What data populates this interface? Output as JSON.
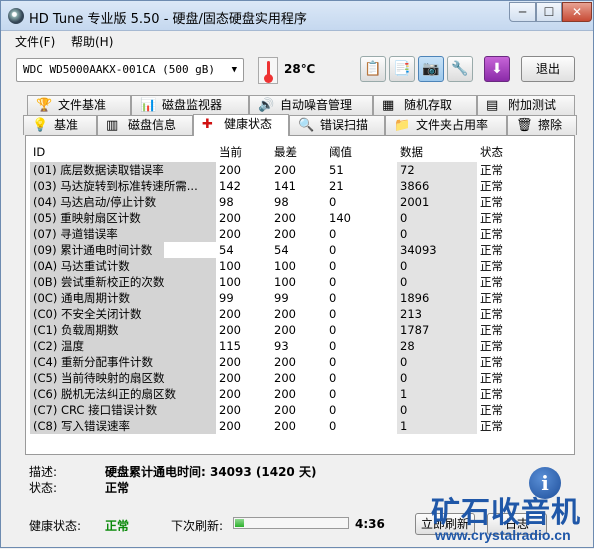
{
  "window": {
    "title": "HD Tune 专业版 5.50 - 硬盘/固态硬盘实用程序",
    "min_icon": "minimize-icon",
    "max_icon": "maximize-icon",
    "close_icon": "close-icon",
    "min_glyph": "─",
    "max_glyph": "☐",
    "close_glyph": "✕"
  },
  "menu": {
    "file": "文件(F)",
    "help": "帮助(H)"
  },
  "toolbar": {
    "drive": "WDC WD5000AAKX-001CA (500 gB)",
    "drive_arrow": "▼",
    "temperature": "28℃",
    "exit": "退出",
    "buttons": [
      {
        "icon": "copy-text-icon",
        "glyph": "📋"
      },
      {
        "icon": "copy-info-icon",
        "glyph": "📑"
      },
      {
        "icon": "screenshot-camera-icon",
        "glyph": "📷"
      },
      {
        "icon": "options-wrench-icon",
        "glyph": "🔧"
      },
      {
        "icon": "save-download-icon",
        "glyph": "⬇"
      }
    ]
  },
  "tabs": {
    "top": [
      {
        "label": "文件基准",
        "icon": "file-benchmark-icon",
        "glyph": "🏆"
      },
      {
        "label": "磁盘监视器",
        "icon": "disk-monitor-icon",
        "glyph": "📊"
      },
      {
        "label": "自动噪音管理",
        "icon": "aam-speaker-icon",
        "glyph": "🔊"
      },
      {
        "label": "随机存取",
        "icon": "random-access-icon",
        "glyph": "▦"
      },
      {
        "label": "附加测试",
        "icon": "extra-tests-icon",
        "glyph": "▤"
      }
    ],
    "bottom": [
      {
        "label": "基准",
        "icon": "benchmark-icon",
        "glyph": "💡"
      },
      {
        "label": "磁盘信息",
        "icon": "disk-info-icon",
        "glyph": "▥"
      },
      {
        "label": "健康状态",
        "icon": "health-cross-icon",
        "glyph": "✚"
      },
      {
        "label": "错误扫描",
        "icon": "error-scan-icon",
        "glyph": "🔍"
      },
      {
        "label": "文件夹占用率",
        "icon": "folder-usage-icon",
        "glyph": "📁"
      },
      {
        "label": "擦除",
        "icon": "erase-trash-icon",
        "glyph": "🗑"
      }
    ]
  },
  "smart": {
    "headers": {
      "id": "ID",
      "current": "当前",
      "worst": "最差",
      "threshold": "阈值",
      "data": "数据",
      "status": "状态"
    },
    "rows": [
      {
        "id": "(01) 底层数据读取错误率",
        "current": "200",
        "worst": "200",
        "threshold": "51",
        "data": "72",
        "status": "正常"
      },
      {
        "id": "(03) 马达旋转到标准转速所需...",
        "current": "142",
        "worst": "141",
        "threshold": "21",
        "data": "3866",
        "status": "正常"
      },
      {
        "id": "(04) 马达启动/停止计数",
        "current": "98",
        "worst": "98",
        "threshold": "0",
        "data": "2001",
        "status": "正常"
      },
      {
        "id": "(05) 重映射扇区计数",
        "current": "200",
        "worst": "200",
        "threshold": "140",
        "data": "0",
        "status": "正常"
      },
      {
        "id": "(07) 寻道错误率",
        "current": "200",
        "worst": "200",
        "threshold": "0",
        "data": "0",
        "status": "正常"
      },
      {
        "id": "(09) 累计通电时间计数",
        "current": "54",
        "worst": "54",
        "threshold": "0",
        "data": "34093",
        "status": "正常"
      },
      {
        "id": "(0A) 马达重试计数",
        "current": "100",
        "worst": "100",
        "threshold": "0",
        "data": "0",
        "status": "正常"
      },
      {
        "id": "(0B) 尝试重新校正的次数",
        "current": "100",
        "worst": "100",
        "threshold": "0",
        "data": "0",
        "status": "正常"
      },
      {
        "id": "(0C) 通电周期计数",
        "current": "99",
        "worst": "99",
        "threshold": "0",
        "data": "1896",
        "status": "正常"
      },
      {
        "id": "(C0) 不安全关闭计数",
        "current": "200",
        "worst": "200",
        "threshold": "0",
        "data": "213",
        "status": "正常"
      },
      {
        "id": "(C1) 负载周期数",
        "current": "200",
        "worst": "200",
        "threshold": "0",
        "data": "1787",
        "status": "正常"
      },
      {
        "id": "(C2) 温度",
        "current": "115",
        "worst": "93",
        "threshold": "0",
        "data": "28",
        "status": "正常"
      },
      {
        "id": "(C4) 重新分配事件计数",
        "current": "200",
        "worst": "200",
        "threshold": "0",
        "data": "0",
        "status": "正常"
      },
      {
        "id": "(C5) 当前待映射的扇区数",
        "current": "200",
        "worst": "200",
        "threshold": "0",
        "data": "0",
        "status": "正常"
      },
      {
        "id": "(C6) 脱机无法纠正的扇区数",
        "current": "200",
        "worst": "200",
        "threshold": "0",
        "data": "1",
        "status": "正常"
      },
      {
        "id": "(C7) CRC 接口错误计数",
        "current": "200",
        "worst": "200",
        "threshold": "0",
        "data": "0",
        "status": "正常"
      },
      {
        "id": "(C8) 写入错误速率",
        "current": "200",
        "worst": "200",
        "threshold": "0",
        "data": "1",
        "status": "正常"
      }
    ],
    "selected_row_index": 5
  },
  "details": {
    "description_label": "描述:",
    "description_value": "硬盘累计通电时间: 34093 (1420 天)",
    "status_label": "状态:",
    "status_value": "正常"
  },
  "footer": {
    "health_label": "健康状态:",
    "health_value": "正常",
    "next_refresh_label": "下次刷新:",
    "refresh_progress": 0.08,
    "countdown": "4:36",
    "refresh_button": "立即刷新",
    "log_button": "日志"
  },
  "watermark": {
    "badge": "i",
    "text": "矿石收音机",
    "url": "www.crystalradio.cn"
  },
  "colors": {
    "ok_green": "#0a8a0a",
    "watermark_blue": "#1f57a8",
    "health_tab_cross": "#d01010"
  }
}
